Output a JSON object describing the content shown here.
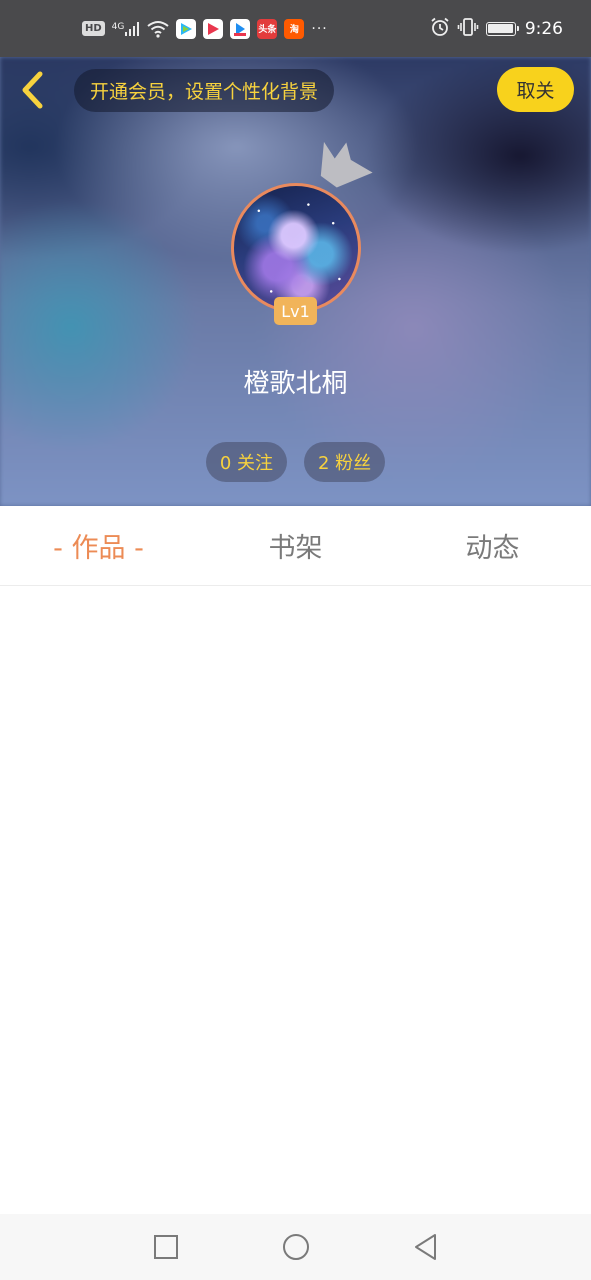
{
  "status_bar": {
    "hd": "HD",
    "network": "4G",
    "apps": [
      {
        "name": "tencent-video-icon",
        "color": "#2cb7f5"
      },
      {
        "name": "video-play-icon",
        "color": "#e9374e"
      },
      {
        "name": "youku-icon",
        "color": "#1f8ef1"
      },
      {
        "name": "toutiao-icon",
        "color": "#e23c3c",
        "text": "头条"
      },
      {
        "name": "taobao-icon",
        "color": "#ff5a00",
        "text": "淘"
      }
    ],
    "more": "···",
    "time": "9:26"
  },
  "header": {
    "vip_banner": "开通会员，设置个性化背景",
    "unfollow_label": "取关",
    "level": "Lv1",
    "username": "橙歌北桐",
    "following": "0 关注",
    "followers": "2 粉丝"
  },
  "tabs": [
    {
      "label": "- 作品 -",
      "active": true
    },
    {
      "label": "书架",
      "active": false
    },
    {
      "label": "动态",
      "active": false
    }
  ],
  "colors": {
    "accent": "#ec8b55",
    "vip_yellow": "#f7d23e",
    "button_yellow": "#f8d21c"
  }
}
